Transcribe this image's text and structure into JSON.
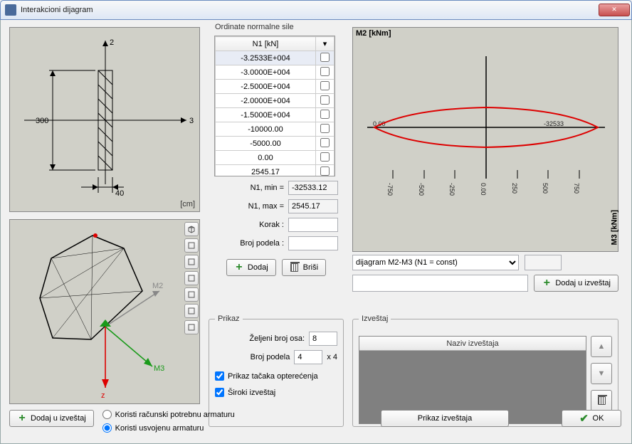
{
  "window": {
    "title": "Interakcioni dijagram",
    "close": "×"
  },
  "section_top": {
    "unit": "[cm]",
    "dim_h": "300",
    "dim_w": "40",
    "axis1": "2",
    "axis2": "3"
  },
  "section_bottom": {
    "m2": "M2",
    "m3": "M3",
    "z": "z"
  },
  "ordinate": {
    "legend": "Ordinate normalne sile",
    "col_n1": "N1 [kN]",
    "rows": [
      {
        "v": "-3.2533E+004",
        "c": false
      },
      {
        "v": "-3.0000E+004",
        "c": false
      },
      {
        "v": "-2.5000E+004",
        "c": false
      },
      {
        "v": "-2.0000E+004",
        "c": false
      },
      {
        "v": "-1.5000E+004",
        "c": false
      },
      {
        "v": "-10000.00",
        "c": false
      },
      {
        "v": "-5000.00",
        "c": false
      },
      {
        "v": "0.00",
        "c": false
      },
      {
        "v": "2545.17",
        "c": false
      }
    ],
    "n1min_lbl": "N1, min =",
    "n1min_val": "-32533.12",
    "n1max_lbl": "N1, max =",
    "n1max_val": "2545.17",
    "korak_lbl": "Korak :",
    "korak_val": "",
    "broj_lbl": "Broj podela :",
    "broj_val": "",
    "btn_add": "Dodaj",
    "btn_del": "Briši"
  },
  "prikaz": {
    "legend": "Prikaz",
    "zeljeni_lbl": "Željeni broj osa:",
    "zeljeni_val": "8",
    "broj_lbl": "Broj podela",
    "broj_val": "4",
    "broj_suffix": "x 4",
    "cb1": "Prikaz tačaka opterećenja",
    "cb2": "Široki izveštaj"
  },
  "chart": {
    "title": "M2 [kNm]",
    "ylabel": "M3 [kNm]",
    "mid_left": "0.00",
    "mid_right": "-32533",
    "xticks": [
      "-750",
      "-500",
      "-250",
      "0.00",
      "250",
      "500",
      "750"
    ]
  },
  "chart_data": {
    "type": "line",
    "title": "dijagram M2-M3 (N1 = const)",
    "xlabel": "M3 [kNm]",
    "ylabel": "M2 [kNm]",
    "xlim": [
      -900,
      900
    ],
    "ylim": [
      -60,
      60
    ],
    "x": [
      -860,
      -700,
      -400,
      0,
      400,
      700,
      860,
      700,
      400,
      0,
      -400,
      -700,
      -860
    ],
    "y": [
      0,
      14,
      24,
      30,
      24,
      14,
      0,
      -14,
      -24,
      -30,
      -24,
      -14,
      0
    ],
    "annotations": [
      {
        "text": "0.00",
        "x": -860,
        "y": 0
      },
      {
        "text": "-32533",
        "x": 580,
        "y": 6
      }
    ]
  },
  "combo": {
    "options": [
      "dijagram M2-M3 (N1 = const)"
    ],
    "selected": "dijagram M2-M3 (N1 = const)"
  },
  "addrep_btn": "Dodaj u izveštaj",
  "report": {
    "legend": "Izveštaj",
    "col": "Naziv izveštaja"
  },
  "bottom": {
    "btn_add": "Dodaj u izveštaj",
    "radio1": "Koristi računski potrebnu armaturu",
    "radio2": "Koristi usvojenu armaturu",
    "btn_show": "Prikaz izveštaja",
    "btn_ok": "OK"
  }
}
